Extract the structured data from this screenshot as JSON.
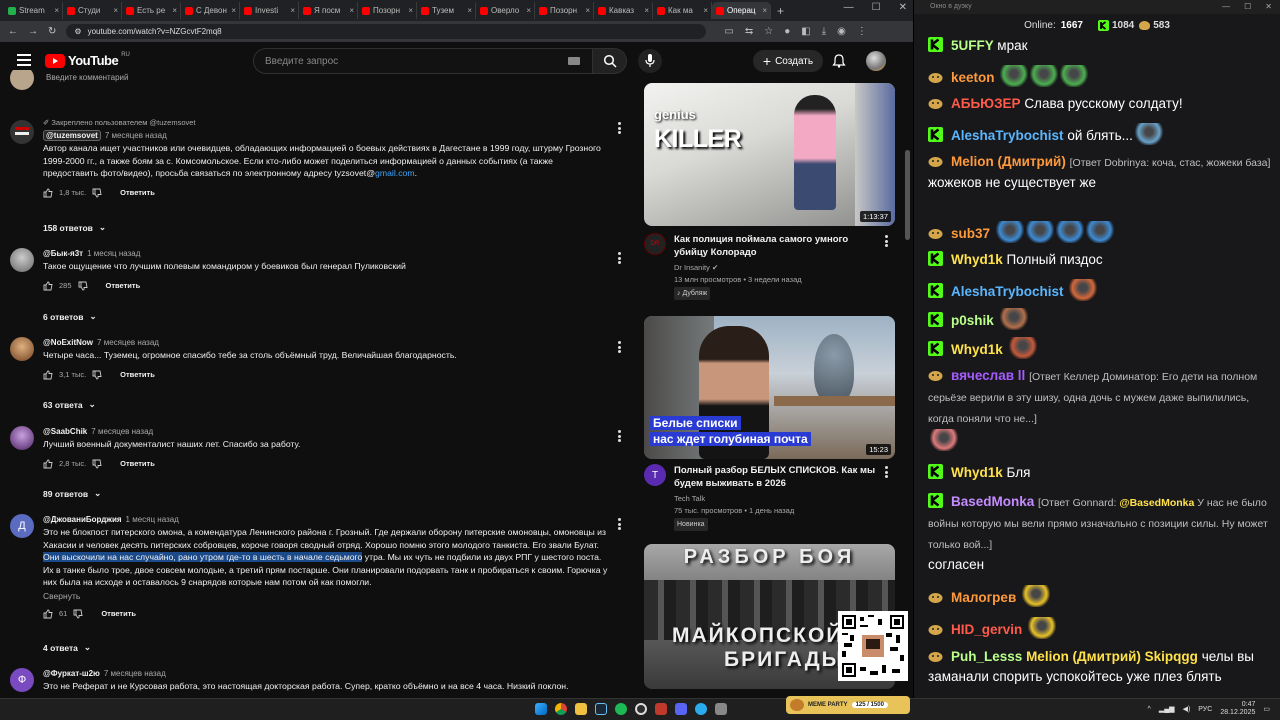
{
  "browser": {
    "tabs": [
      "Stream",
      "Студи",
      "Есть ре",
      "С Девон",
      "Investi",
      "Я посм",
      "Позорн",
      "Тузем",
      "Оверло",
      "Позорн",
      "Кавказ",
      "Как ма",
      "Операц"
    ],
    "url": "youtube.com/watch?v=NZGcvtF2mq8"
  },
  "youtube": {
    "logo_text": "YouTube",
    "logo_region": "RU",
    "search_placeholder": "Введите запрос",
    "create_label": "Создать"
  },
  "comments": {
    "input_placeholder": "Введите комментарий",
    "items": [
      {
        "pinned": "Закреплено пользователем @tuzemsovet",
        "author": "@tuzemsovet",
        "time": "7 месяцев назад",
        "text_a": "Автор канала ищет участников или очевидцев, обладающих информацией  о боевых действиях в Дагестане в 1999 году, штурму Грозного 1999-2000 гг., а также боям за с. Комсомольское. Если кто-либо может поделиться информацией о данных событиях (а также предоставить фото/видео), просьба связаться по электронному адресу tyzsovet@",
        "link": "gmail.com",
        "text_b": ".",
        "likes": "1,8 тыс.",
        "reply": "Ответить",
        "replies": "158 ответов"
      },
      {
        "author": "@Бык-я3т",
        "time": "1 месяц назад",
        "text": "Такое ощущение что лучшим полевым командиром у боевиков был генерал Пуликовский",
        "likes": "285",
        "reply": "Ответить",
        "replies": "6 ответов"
      },
      {
        "author": "@NoExitNow",
        "time": "7 месяцев назад",
        "text": "Четыре часа... Туземец, огромное спасибо тебе за столь объёмный труд. Величайшая благодарность.",
        "likes": "3,1 тыс.",
        "reply": "Ответить",
        "replies": "63 ответа"
      },
      {
        "author": "@SaabChik",
        "time": "7 месяцев назад",
        "text": "Лучший военный документалист наших лет. Спасибо за работу.",
        "likes": "2,8 тыс.",
        "reply": "Ответить",
        "replies": "89 ответов"
      },
      {
        "author": "@ДжованиБорджия",
        "time": "1 месяц назад",
        "text_a": "Это не блокпост питерского омона, а комендатура Ленинского района г. Грозный. Где держали оборону питерские омоновцы, омоновцы из Хакасии и человек десять питерских собровцев, короче говоря сводный отряд. Хорошо помню этого молодого танкиста. Его звали Булат. ",
        "text_hl": "Они выскочили на нас случайно, рано утром где-то в шесть в начале седьмого",
        "text_b": " утра. Мы их чуть не подбили из двух РПГ у шестого поста. Их в танке было трое, двое совсем молодые, а третий прям постарше. Они планировали подорвать танк и пробираться к своим. Горючка у них была на исходе и оставалось 9 снарядов которые нам потом ой как помогли.",
        "collapse": "Свернуть",
        "likes": "61",
        "reply": "Ответить",
        "replies": "4 ответа"
      },
      {
        "author": "@Фуркат-ш2ю",
        "time": "7 месяцев назад",
        "text": "Это не Реферат и не Курсовая работа, это настоящая докторская работа. Супер, кратко объёмно и на все 4 часа. Низкий поклон."
      }
    ]
  },
  "recommendations": [
    {
      "thumb_text_1": "genius",
      "thumb_text_2": "KILLER",
      "duration": "1:13:37",
      "title": "Как полиция поймала самого умного убийцу Колорадо",
      "channel": "Dr Insanity",
      "stats": "13 млн просмотров • 3 недели назад",
      "badge": "Дубляж"
    },
    {
      "thumb_text_1": "Белые списки",
      "thumb_text_2": "нас ждет голубиная почта",
      "duration": "15:23",
      "title": "Полный разбор БЕЛЫХ СПИСКОВ.  Как мы будем выживать в 2026",
      "channel": "Tech Talk",
      "stats": "75 тыс. просмотров • 1 день назад",
      "badge": "Новинка"
    },
    {
      "thumb_text_1": "РАЗБОР БОЯ",
      "thumb_text_2": "МАЙКОПСКОЙ",
      "thumb_text_3": "БРИГАДЫ"
    }
  ],
  "chat": {
    "window_title": "Окно в дуэку",
    "online_label": "Online:",
    "online_count": "1667",
    "stat_a": "1084",
    "stat_b": "583",
    "messages": [
      {
        "user": "5UFFY",
        "color": "#b9ff8a",
        "badge": "kick",
        "text": "мрак"
      },
      {
        "user": "keeton",
        "color": "#ff9a3c",
        "badge": "star",
        "emotes": 3,
        "emote_color": "#4caf50"
      },
      {
        "user": "АБЬЮЗЕР",
        "color": "#ff5a4a",
        "badge": "star",
        "text": "Слава русскому солдату!"
      },
      {
        "user": "AleshaTrybochist",
        "color": "#5ab7ff",
        "badge": "kick",
        "text": "ой блять...",
        "emotes": 1,
        "emote_color": "#6aa3c9"
      },
      {
        "user": "Melion (Дмитрий)",
        "color": "#ff9a3c",
        "badge": "star",
        "reply": "[Ответ Dobrinya: коча, стас, жожеки база]",
        "text": "жожеков не существует же"
      },
      {
        "user": "sub37",
        "color": "#ff9a3c",
        "badge": "star",
        "emotes": 4,
        "emote_color": "#3d8bd4"
      },
      {
        "user": "Whyd1k",
        "color": "#ffe14a",
        "badge": "kick",
        "text": "Полный пиздос"
      },
      {
        "user": "AleshaTrybochist",
        "color": "#5ab7ff",
        "badge": "kick",
        "emotes": 1,
        "emote_color": "#d4683a"
      },
      {
        "user": "p0shik",
        "color": "#b9ff8a",
        "badge": "kick",
        "emotes": 1,
        "emote_color": "#b2704a"
      },
      {
        "user": "Whyd1k",
        "color": "#ffe14a",
        "badge": "kick",
        "emotes": 1,
        "emote_color": "#c45a3a"
      },
      {
        "user": "вячеслав ll",
        "color": "#a55cff",
        "badge": "star",
        "reply": "[Ответ Келлер Доминатор: Его дети на полном серьёзе верили в эту шизу, одна дочь с мужем даже выпилились, когда поняли что не...]",
        "emotes": 1,
        "emote_color": "#e07a7a"
      },
      {
        "user": "Whyd1k",
        "color": "#ffe14a",
        "badge": "kick",
        "text": "Бля"
      },
      {
        "user": "BasedMonka",
        "color": "#c48cff",
        "badge": "kick",
        "reply_prefix": "[Ответ Gonnard: ",
        "mention": "@BasedMonka",
        "reply": " У нас не было войны которую мы вели прямо изначально с позиции силы. Ну может только вой...]",
        "text": "согласен"
      },
      {
        "user": "Малогрев",
        "color": "#ff9a3c",
        "badge": "star",
        "emotes": 1,
        "emote_color": "#e8c12a"
      },
      {
        "user": "HID_gervin",
        "color": "#ff5a4a",
        "badge": "star",
        "emotes": 1,
        "emote_color": "#e8c12a"
      },
      {
        "user": "Puh_Lesss",
        "color": "#b9ff8a",
        "badge": "star",
        "mentions": "Melion (Дмитрий) Skipqgg",
        "text": "челы вы заманали спорить успокойтесь уже плез блять"
      }
    ]
  },
  "overlay": {
    "meme_label": "MEME PARTY",
    "meme_count": "125 / 1500"
  },
  "taskbar": {
    "lang": "РУС",
    "time": "0:47",
    "date": "28.12.2025"
  },
  "colors": {
    "youtube_red": "#ff0000",
    "link": "#3ea6ff",
    "kick_green": "#53fc18",
    "chat_bg": "#18181b"
  }
}
